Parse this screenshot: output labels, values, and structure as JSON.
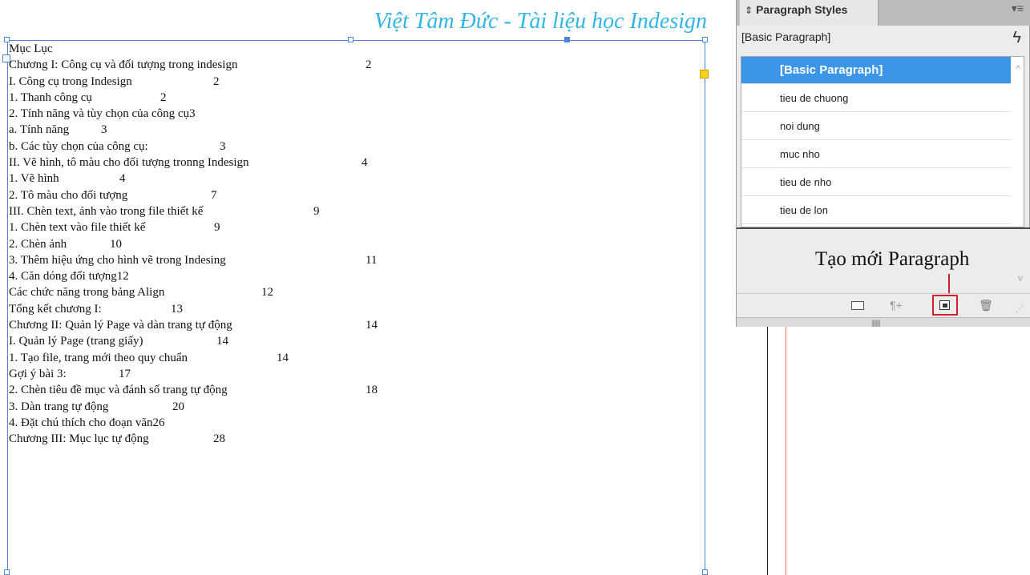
{
  "document": {
    "title": "Việt Tâm Đức - Tài liệu học Indesign",
    "toc": [
      {
        "text": "Mục Lục",
        "page": ""
      },
      {
        "text": "Chương I: Công cụ và đối tượng trong indesign",
        "page": "2"
      },
      {
        "text": "I. Công cụ trong Indesign",
        "page": "2"
      },
      {
        "text": "1. Thanh công cụ",
        "page": "2"
      },
      {
        "text": "2. Tính năng và tùy chọn của công cụ3",
        "page": ""
      },
      {
        "text": "a. Tính năng",
        "page": "3"
      },
      {
        "text": "b. Các tùy chọn của công cụ:",
        "page": "3"
      },
      {
        "text": "II. Vẽ hình, tô màu cho đối tượng tronng Indesign",
        "page": "4"
      },
      {
        "text": "1. Vẽ hình",
        "page": "4"
      },
      {
        "text": "2. Tô màu cho đối tượng",
        "page": "7"
      },
      {
        "text": "III. Chèn text, ảnh vào trong file thiết kế",
        "page": "9"
      },
      {
        "text": "1. Chèn text vào file thiết kế",
        "page": "9"
      },
      {
        "text": "2. Chèn ảnh",
        "page": "10"
      },
      {
        "text": "3. Thêm hiệu ứng cho hình vẽ trong Indesing",
        "page": "11"
      },
      {
        "text": "4. Căn dóng đối tượng12",
        "page": ""
      },
      {
        "text": "Các chức năng trong bảng Align",
        "page": "12"
      },
      {
        "text": "Tổng kết chương I:",
        "page": "13"
      },
      {
        "text": "Chương II: Quản lý Page và dàn trang tự động",
        "page": "14"
      },
      {
        "text": "I. Quản lý Page (trang giấy)",
        "page": "14"
      },
      {
        "text": "1. Tạo file, trang mới theo quy chuẩn",
        "page": "14"
      },
      {
        "text": "Gợi ý bài 3:",
        "page": "17"
      },
      {
        "text": "2. Chèn tiêu đề mục và đánh số trang tự động",
        "page": "18"
      },
      {
        "text": "3. Dàn trang tự động",
        "page": "20"
      },
      {
        "text": "4. Đặt chú thích cho đoạn văn26",
        "page": ""
      },
      {
        "text": "Chương III: Mục lục tự động",
        "page": "28"
      }
    ]
  },
  "panel": {
    "tab_label": "Paragraph Styles",
    "menu_icon": "panel-menu-icon",
    "current_style": "[Basic Paragraph]",
    "styles": [
      {
        "label": "[Basic Paragraph]",
        "selected": true
      },
      {
        "label": "tieu de chuong",
        "selected": false
      },
      {
        "label": "noi dung",
        "selected": false
      },
      {
        "label": "muc nho",
        "selected": false
      },
      {
        "label": "tieu de nho",
        "selected": false
      },
      {
        "label": "tieu de lon",
        "selected": false
      }
    ],
    "annotation": "Tạo mới Paragraph",
    "bottom_icons": [
      "folder-icon",
      "clear-overrides-icon",
      "new-style-icon",
      "trash-icon"
    ]
  },
  "colors": {
    "title": "#31b5e6",
    "frame": "#4a86d9",
    "selection": "#3c96e8",
    "annotation_box": "#d0202a"
  }
}
